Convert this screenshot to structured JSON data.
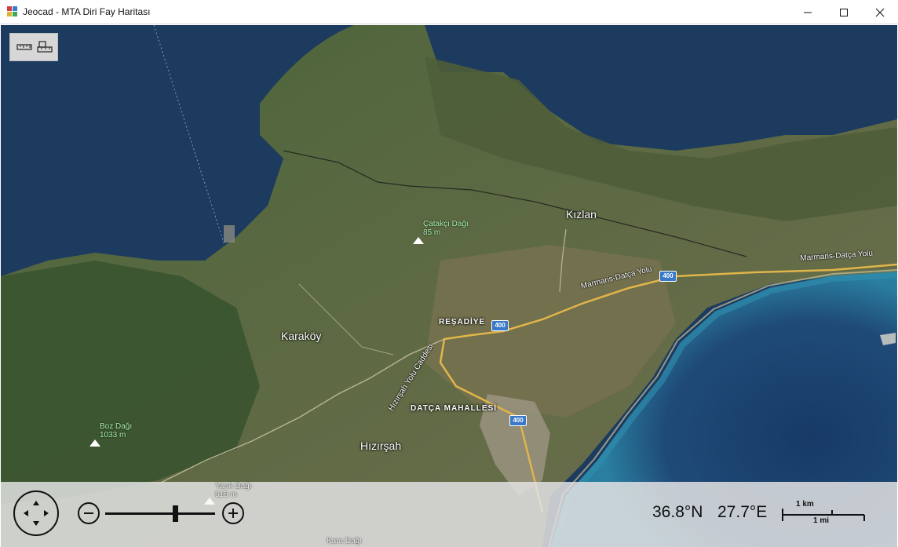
{
  "window": {
    "title": "Jeocad - MTA Diri Fay Haritası"
  },
  "toolbar": {
    "tools": [
      {
        "name": "ruler-tool-icon"
      },
      {
        "name": "area-measure-tool-icon"
      }
    ]
  },
  "map": {
    "towns": [
      {
        "name": "Kızlan"
      },
      {
        "name": "Karaköy"
      },
      {
        "name": "Hızırşah"
      }
    ],
    "districts": [
      {
        "name": "REŞADİYE"
      },
      {
        "name": "DATÇA MAHALLESİ"
      }
    ],
    "peaks": [
      {
        "name": "Çatakçı Dağı",
        "elevation": "85 m"
      },
      {
        "name": "Boz Dağı",
        "elevation": "1033 m"
      },
      {
        "name": "Yarık Dağı",
        "elevation": "615 m"
      },
      {
        "name": "Kara Dağı",
        "elevation": ""
      }
    ],
    "roads": [
      {
        "name": "Marmaris-Datça Yolu"
      },
      {
        "name": "Marmaris-Datça Yolu"
      },
      {
        "name": "Hızırşah Yolu Caddesi"
      }
    ],
    "route_shields": [
      "400",
      "400",
      "400"
    ]
  },
  "controls": {
    "latitude": "36.8°N",
    "longitude": "27.7°E",
    "scale_km": "1 km",
    "scale_mi": "1 mi",
    "zoom_level_fraction": 0.64
  },
  "colors": {
    "sea_deep": "#1c3a5e",
    "sea_shallow": "#2a6f93",
    "land_forest": "#3f5a33",
    "land_farm": "#6b6a49",
    "road": "#e0b54a"
  }
}
